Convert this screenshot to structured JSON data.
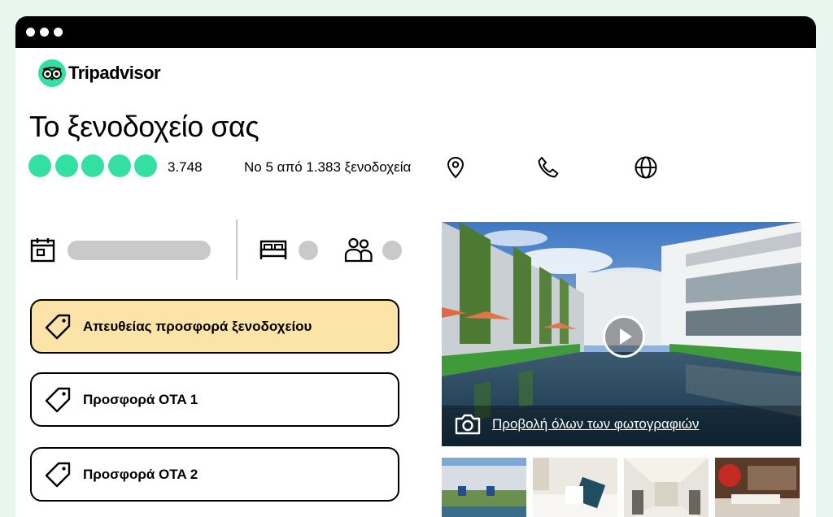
{
  "brand": {
    "name": "Tripadvisor"
  },
  "hotel": {
    "title": "Το ξενοδοχείο σας",
    "rating_bubbles": 5,
    "reviews_count": "3.748",
    "rank_text": "Νο 5 από 1.383 ξενοδοχεία"
  },
  "contact_icons": [
    "location-pin-icon",
    "phone-icon",
    "globe-icon"
  ],
  "search_bar": {
    "icons": [
      "calendar-icon",
      "bed-icon",
      "guests-icon"
    ]
  },
  "offers": [
    {
      "label": "Απευθείας προσφορά ξενοδοχείου",
      "highlighted": true
    },
    {
      "label": "Προσφορά OTA 1",
      "highlighted": false
    },
    {
      "label": "Προσφορά OTA 2",
      "highlighted": false
    }
  ],
  "gallery": {
    "view_all_label": "Προβολή όλων των φωτογραφιών",
    "thumbnails_count": 4
  },
  "colors": {
    "brand_green": "#34e0a1",
    "highlight_offer": "#fce4a8",
    "page_background": "#e8f6ef",
    "placeholder_gray": "#c9c9c9"
  }
}
